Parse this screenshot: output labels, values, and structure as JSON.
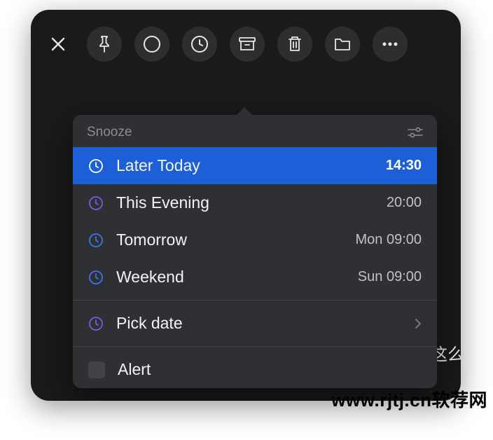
{
  "popover": {
    "title": "Snooze",
    "options": [
      {
        "label": "Later Today",
        "time": "14:30",
        "icon_color": "#ffffff"
      },
      {
        "label": "This Evening",
        "time": "20:00",
        "icon_color": "#7c5bd6"
      },
      {
        "label": "Tomorrow",
        "time": "Mon 09:00",
        "icon_color": "#3b76e8"
      },
      {
        "label": "Weekend",
        "time": "Sun 09:00",
        "icon_color": "#3b76e8"
      }
    ],
    "pick_date_label": "Pick date",
    "alert_label": "Alert"
  },
  "background_snippet": "我就这么",
  "watermark": "www.rjtj.cn软荐网"
}
